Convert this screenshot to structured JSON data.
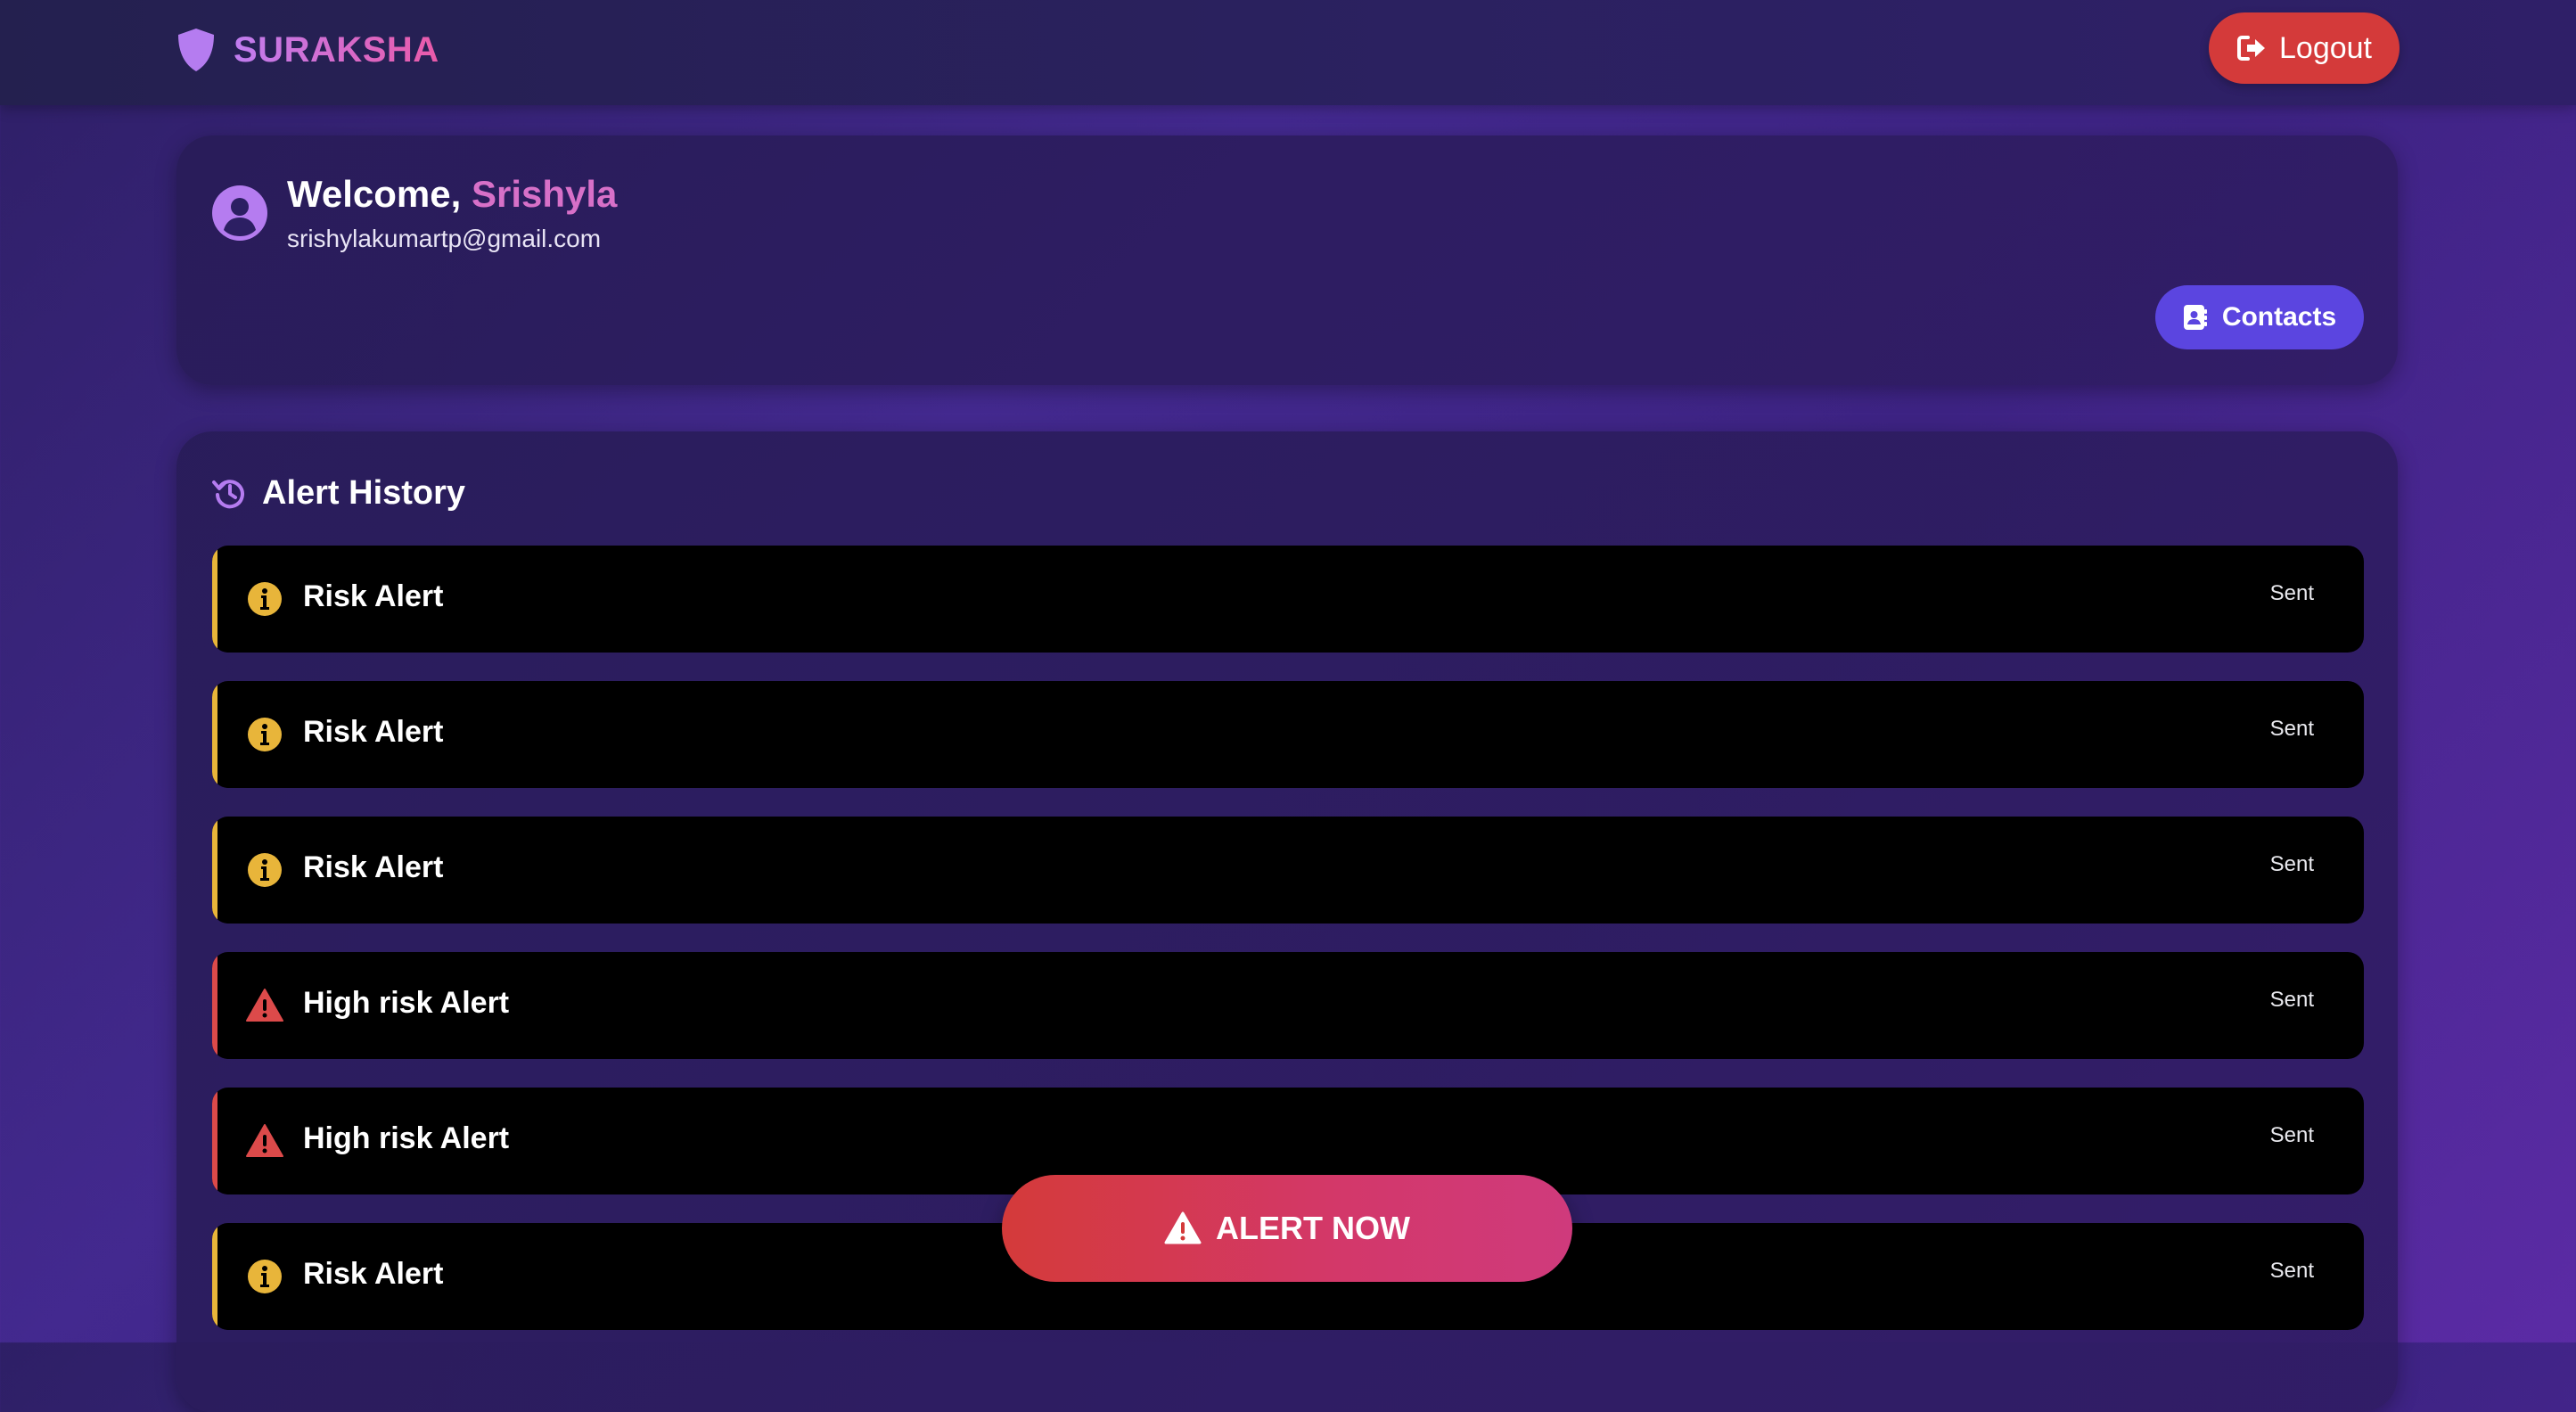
{
  "navbar": {
    "brand": "SURAKSHA",
    "brand_icon": "shield-icon",
    "logout_label": "Logout",
    "logout_icon": "sign-out-icon"
  },
  "welcome": {
    "greeting": "Welcome,",
    "name": "Srishyla",
    "email": "srishylakumartp@gmail.com",
    "avatar_icon": "user-circle-icon",
    "contacts_label": "Contacts",
    "contacts_icon": "address-book-icon"
  },
  "history": {
    "title": "Alert History",
    "title_icon": "history-icon",
    "alerts": [
      {
        "title": "Risk Alert",
        "status": "Sent",
        "level": "risk",
        "icon": "info-circle-icon"
      },
      {
        "title": "Risk Alert",
        "status": "Sent",
        "level": "risk",
        "icon": "info-circle-icon"
      },
      {
        "title": "Risk Alert",
        "status": "Sent",
        "level": "risk",
        "icon": "info-circle-icon"
      },
      {
        "title": "High risk Alert",
        "status": "Sent",
        "level": "high",
        "icon": "warning-triangle-icon"
      },
      {
        "title": "High risk Alert",
        "status": "Sent",
        "level": "high",
        "icon": "warning-triangle-icon"
      },
      {
        "title": "Risk Alert",
        "status": "Sent",
        "level": "risk",
        "icon": "info-circle-icon"
      }
    ]
  },
  "alert_now": {
    "label": "ALERT NOW",
    "icon": "warning-triangle-icon"
  },
  "colors": {
    "risk": "#e8b53a",
    "high": "#dc4a4a",
    "accent_purple": "#b57cf0",
    "name_pink": "#d770c8",
    "logout_red": "#d43a3a",
    "contacts_blue": "#5b45e0"
  }
}
